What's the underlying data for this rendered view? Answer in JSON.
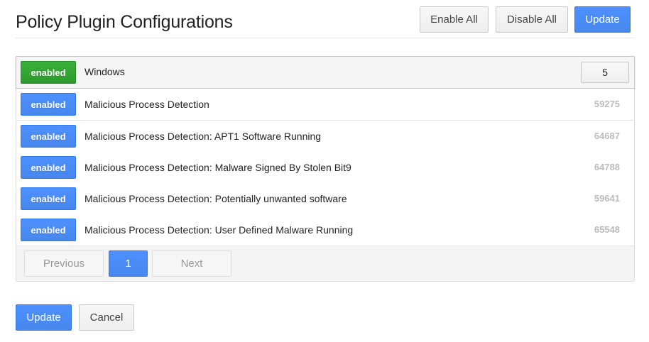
{
  "header": {
    "title": "Policy Plugin Configurations",
    "enable_all_label": "Enable All",
    "disable_all_label": "Disable All",
    "update_label": "Update"
  },
  "group": {
    "status": "enabled",
    "name": "Windows",
    "count": "5"
  },
  "rows": [
    {
      "status": "enabled",
      "name": "Malicious Process Detection",
      "id": "59275"
    },
    {
      "status": "enabled",
      "name": "Malicious Process Detection: APT1 Software Running",
      "id": "64687"
    },
    {
      "status": "enabled",
      "name": "Malicious Process Detection: Malware Signed By Stolen Bit9",
      "id": "64788"
    },
    {
      "status": "enabled",
      "name": "Malicious Process Detection: Potentially unwanted software",
      "id": "59641"
    },
    {
      "status": "enabled",
      "name": "Malicious Process Detection: User Defined Malware Running",
      "id": "65548"
    }
  ],
  "pagination": {
    "previous_label": "Previous",
    "current_page": "1",
    "next_label": "Next"
  },
  "footer": {
    "update_label": "Update",
    "cancel_label": "Cancel"
  },
  "colors": {
    "accent_blue": "#4d90fe",
    "enabled_green": "#2d9a2d",
    "id_gray": "#bbbbbb"
  }
}
